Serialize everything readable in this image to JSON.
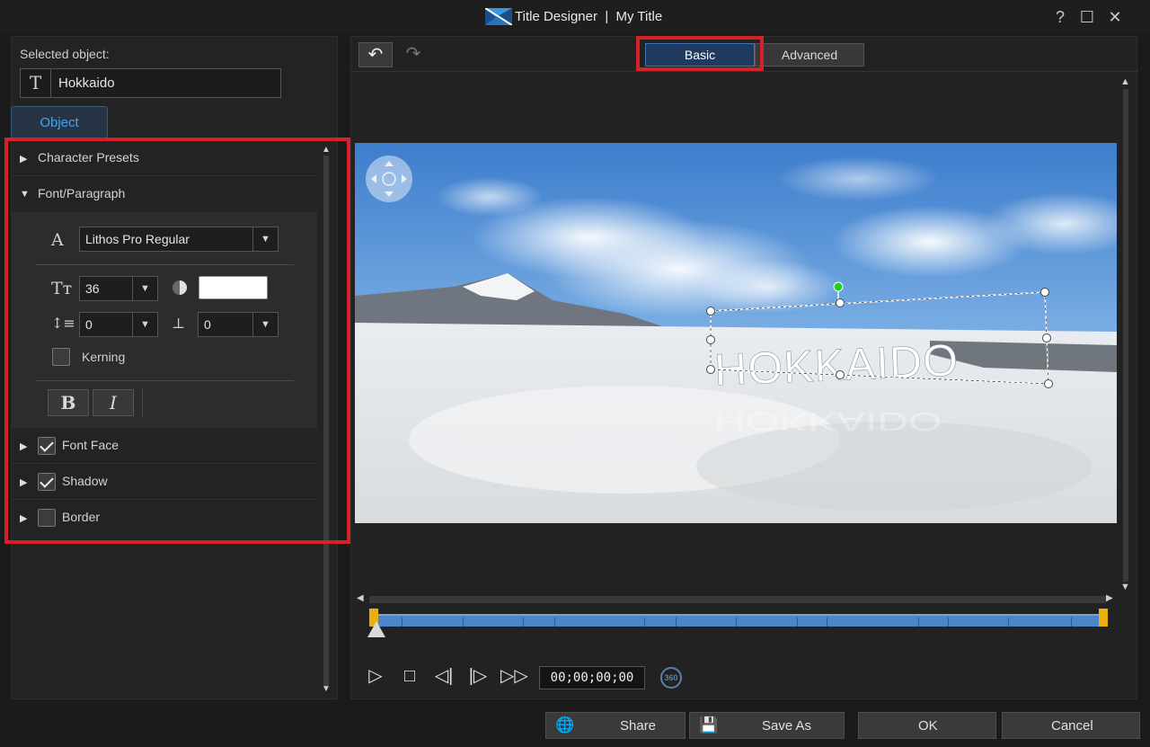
{
  "window": {
    "title": "Title Designer  |  My Title",
    "help_glyph": "?",
    "max_glyph": "☐",
    "close_glyph": "✕"
  },
  "left": {
    "selected_label": "Selected object:",
    "selected_value": "Hokkaido",
    "selected_icon_glyph": "T",
    "tab_object": "Object",
    "sections": {
      "character_presets": "Character Presets",
      "font_paragraph": "Font/Paragraph",
      "font_face": "Font Face",
      "shadow": "Shadow",
      "border": "Border"
    },
    "font": {
      "family": "Lithos Pro Regular",
      "size": "36",
      "line_spacing": "0",
      "char_spacing": "0",
      "kerning_label": "Kerning",
      "bold_glyph": "B",
      "italic_glyph": "I",
      "color": "#ffffff"
    },
    "checks": {
      "font_face": true,
      "shadow": true,
      "border": false,
      "kerning": false
    }
  },
  "right": {
    "mode_basic": "Basic",
    "mode_advanced": "Advanced",
    "preview_title": "HOKKAIDO",
    "timecode": "00;00;00;00",
    "badge_360": "360"
  },
  "buttons": {
    "share": "Share",
    "save_as": "Save As",
    "ok": "OK",
    "cancel": "Cancel"
  },
  "colors": {
    "accent": "#3ea7f0",
    "highlight": "#d6202a",
    "timeline": "#4a86c8",
    "marker": "#e8b10e"
  }
}
